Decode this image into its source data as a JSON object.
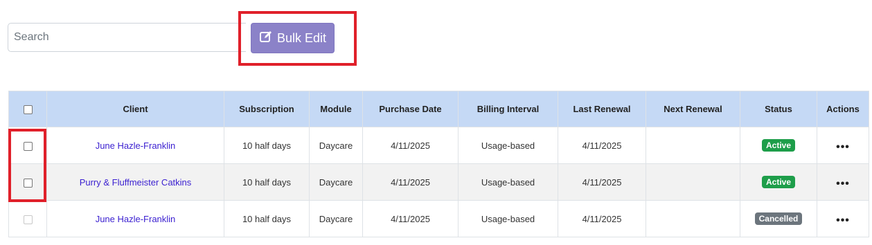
{
  "toolbar": {
    "search_placeholder": "Search",
    "search_value": "",
    "bulk_edit_label": "Bulk Edit",
    "bulk_edit_icon": "edit-square-icon",
    "bulk_edit_color": "#8b82c8"
  },
  "table": {
    "columns": [
      "Client",
      "Subscription",
      "Module",
      "Purchase Date",
      "Billing Interval",
      "Last Renewal",
      "Next Renewal",
      "Status",
      "Actions"
    ],
    "rows": [
      {
        "client": "June Hazle-Franklin",
        "subscription": "10 half days",
        "module": "Daycare",
        "purchase_date": "4/11/2025",
        "billing_interval": "Usage-based",
        "last_renewal": "4/11/2025",
        "next_renewal": "",
        "status": "Active",
        "actions": "•••"
      },
      {
        "client": "Purry & Fluffmeister Catkins",
        "subscription": "10 half days",
        "module": "Daycare",
        "purchase_date": "4/11/2025",
        "billing_interval": "Usage-based",
        "last_renewal": "4/11/2025",
        "next_renewal": "",
        "status": "Active",
        "actions": "•••"
      },
      {
        "client": "June Hazle-Franklin",
        "subscription": "10 half days",
        "module": "Daycare",
        "purchase_date": "4/11/2025",
        "billing_interval": "Usage-based",
        "last_renewal": "4/11/2025",
        "next_renewal": "",
        "status": "Cancelled",
        "actions": "•••"
      }
    ]
  },
  "colors": {
    "header_bg": "#c5d9f5",
    "link": "#3a1fd0",
    "active_badge": "#1e9e4a",
    "cancelled_badge": "#6c757d",
    "highlight": "#e0202a"
  }
}
